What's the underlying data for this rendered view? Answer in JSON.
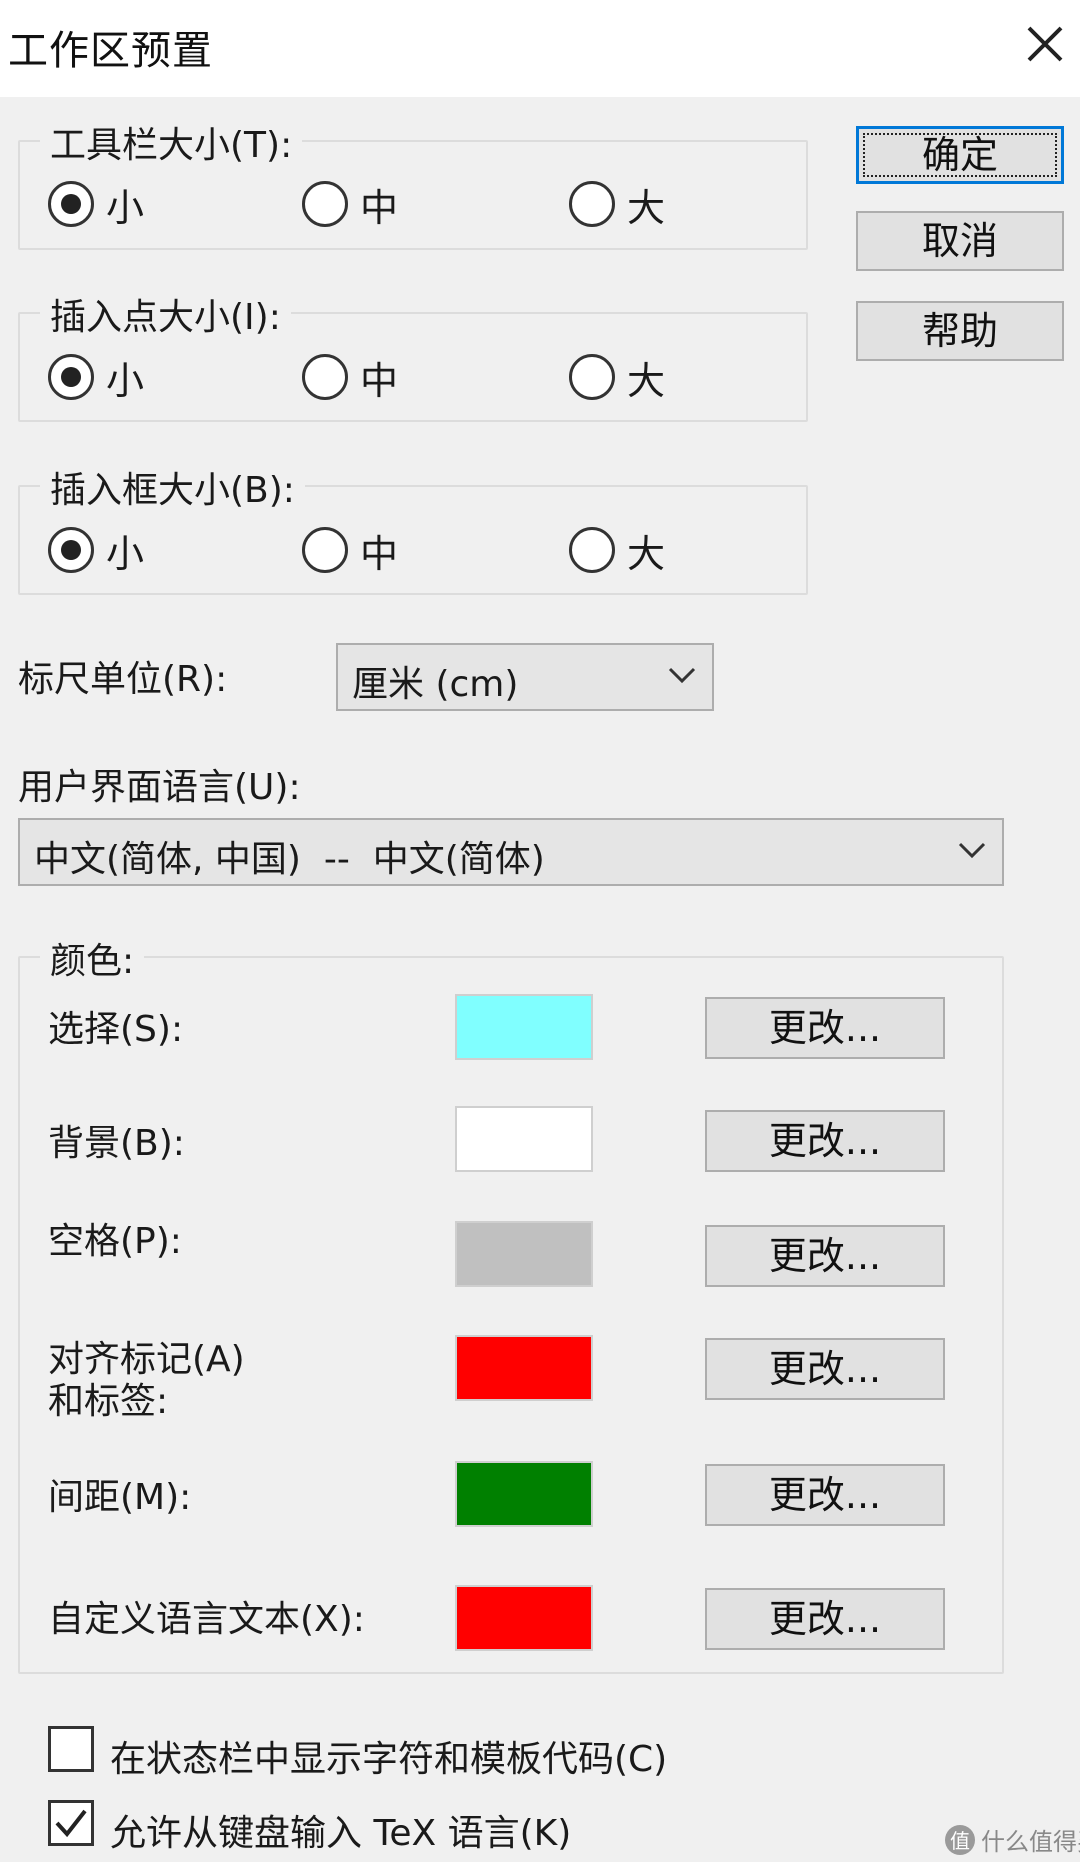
{
  "window": {
    "title": "工作区预置"
  },
  "buttons": {
    "ok": "确定",
    "cancel": "取消",
    "help": "帮助"
  },
  "groups": [
    {
      "legend": "工具栏大小(T):",
      "options": [
        "小",
        "中",
        "大"
      ],
      "selected": 0
    },
    {
      "legend": "插入点大小(I):",
      "options": [
        "小",
        "中",
        "大"
      ],
      "selected": 0
    },
    {
      "legend": "插入框大小(B):",
      "options": [
        "小",
        "中",
        "大"
      ],
      "selected": 0
    }
  ],
  "ruler": {
    "label": "标尺单位(R):",
    "value": "厘米 (cm)"
  },
  "ui_language": {
    "label": "用户界面语言(U):",
    "value": "中文(简体, 中国)  --  中文(简体)"
  },
  "colors": {
    "legend": "颜色:",
    "rows": [
      {
        "label": "选择(S):",
        "color": "#80ffff",
        "button": "更改..."
      },
      {
        "label": "背景(B):",
        "color": "#ffffff",
        "button": "更改..."
      },
      {
        "label": "空格(P):",
        "color": "#c0c0c0",
        "button": "更改..."
      },
      {
        "label": "对齐标记(A)",
        "label2": "和标签:",
        "color": "#ff0000",
        "button": "更改..."
      },
      {
        "label": "间距(M):",
        "color": "#008000",
        "button": "更改..."
      },
      {
        "label": "自定义语言文本(X):",
        "color": "#ff0000",
        "button": "更改..."
      }
    ]
  },
  "checkboxes": [
    {
      "label": "在状态栏中显示字符和模板代码(C)",
      "checked": false
    },
    {
      "label": "允许从键盘输入 TeX 语言(K)",
      "checked": true
    }
  ],
  "watermark": {
    "badge": "值",
    "text": "什么值得买"
  }
}
